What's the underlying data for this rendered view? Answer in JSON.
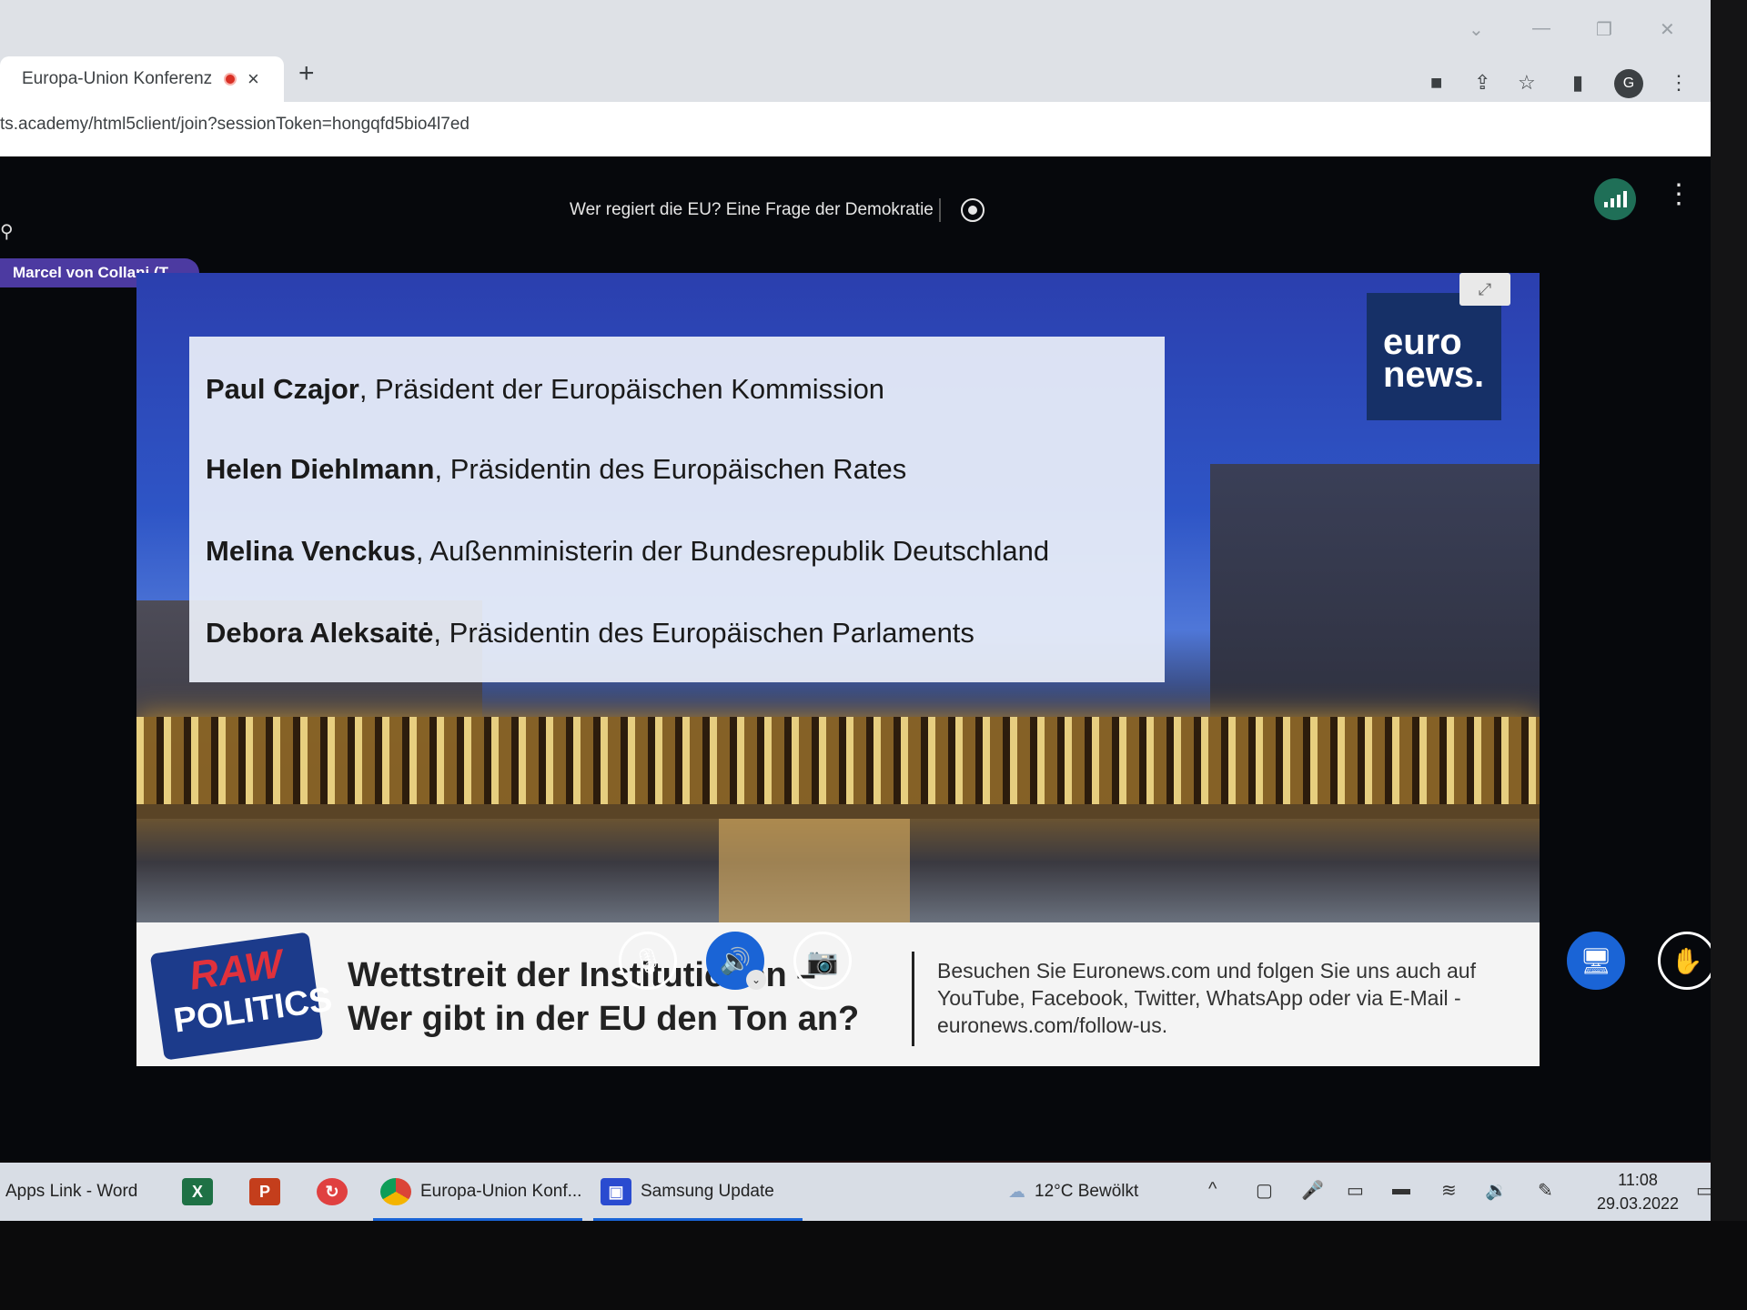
{
  "browser": {
    "tab_title": "Europa-Union Konferenz",
    "tab_close": "×",
    "new_tab": "+",
    "url": "ts.academy/html5client/join?sessionToken=hongqfd5bio4l7ed",
    "profile_initial": "G",
    "window_controls": {
      "minimize": "—",
      "restore": "❐",
      "close": "✕",
      "dropdown": "⌄"
    }
  },
  "meeting": {
    "title": "Wer regiert die EU? Eine Frage der Demokratie",
    "talking_indicator": "Marcel von Collani (T...",
    "more_options": "⋮"
  },
  "presentation": {
    "logo": {
      "line1": "euro",
      "line2": "news."
    },
    "guests": [
      {
        "name": "Paul Czajor",
        "role": ", Präsident der Europäischen Kommission"
      },
      {
        "name": "Helen Diehlmann",
        "role": ", Präsidentin des Europäischen Rates"
      },
      {
        "name": "Melina Venckus",
        "role": ", Außenministerin der Bundesrepublik Deutschland"
      },
      {
        "name": "Debora Aleksaitė",
        "role": ", Präsidentin des Europäischen Parlaments"
      }
    ],
    "banner": {
      "show_logo_top": "RAW",
      "show_logo_bottom": "POLITICS",
      "headline_line1": "Wettstreit der Institutionen –",
      "headline_line2": "Wer gibt in der EU den Ton an?",
      "info": "Besuchen Sie Euronews.com und folgen Sie uns auch auf YouTube, Facebook, Twitter, WhatsApp oder via E-Mail - euronews.com/follow-us."
    }
  },
  "controls": {
    "mute_icon": "🎙",
    "volume_icon": "🔊",
    "camera_icon": "📷",
    "present_icon": "🖥",
    "raise_hand_icon": "✋",
    "caret": "⌄"
  },
  "taskbar": {
    "apps_link": "Apps Link - Word",
    "excel_icon": "X",
    "powerpoint_icon": "P",
    "chrome_label": "Europa-Union Konf...",
    "samsung_update": "Samsung Update",
    "weather": "12°C  Bewölkt",
    "time": "11:08",
    "date": "29.03.2022"
  }
}
